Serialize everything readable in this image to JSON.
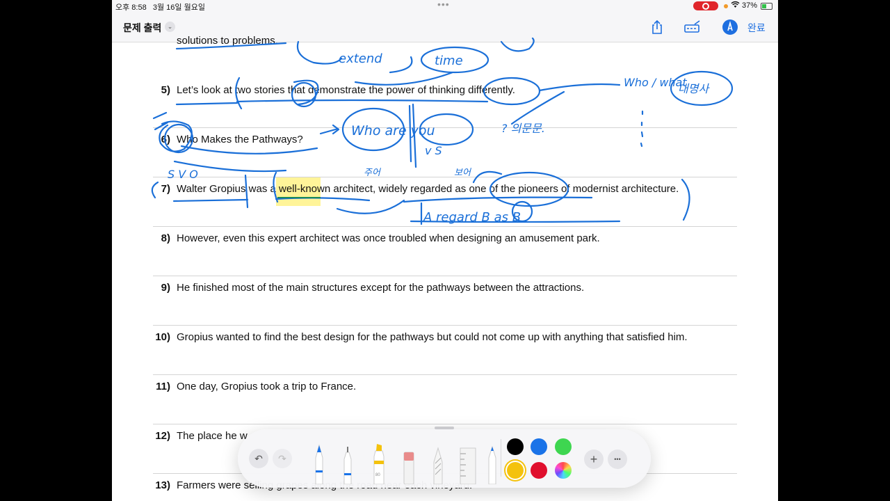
{
  "status": {
    "time": "오후 8:58",
    "date": "3월 16일 월요일",
    "battery": "37%",
    "more_dots": "•••"
  },
  "nav": {
    "title": "문제 출력",
    "chevron": "⌄",
    "done_label": "완료",
    "icons": [
      "share-icon",
      "markup-icon",
      "pen-circle-icon"
    ]
  },
  "worksheet": {
    "top_fragment": "solutions to problems.",
    "rows": [
      {
        "num": "5)",
        "text": "Let’s look at two stories that demonstrate the power of thinking differently."
      },
      {
        "num": "6)",
        "text": "Who Makes the Pathways?"
      },
      {
        "num": "7)",
        "text": "Walter Gropius was a well-known architect, widely regarded as one of the pioneers of modernist architecture."
      },
      {
        "num": "8)",
        "text": "However, even this expert architect was once troubled when designing an amusement park."
      },
      {
        "num": "9)",
        "text": "He finished most of the main structures except for the pathways between the attractions."
      },
      {
        "num": "10)",
        "text": "Gropius wanted to find the best design for the pathways but could not come up with anything that satisfied him."
      },
      {
        "num": "11)",
        "text": "One day, Gropius took a trip to France."
      },
      {
        "num": "12)",
        "text": "The place he w"
      },
      {
        "num": "13)",
        "text": "Farmers were selling grapes along the road near each vineyard."
      }
    ],
    "highlighted_phrase": "well-known"
  },
  "handwriting": {
    "extend": "extend",
    "time": "time",
    "who_what": "Who / what",
    "pronoun_kr": "대명사",
    "who_are_you": "Who are you",
    "question_kr": "? 의문문.",
    "v_s": "v S",
    "s_v_o": "S V O",
    "subject_kr": "주어",
    "complement_kr": "보어",
    "regard_rule": "A regard B as B"
  },
  "toolbar": {
    "undo": "↶",
    "redo": "↷",
    "add": "+",
    "more": "•••",
    "tools": [
      "pen",
      "fineliner",
      "highlighter",
      "eraser",
      "lasso",
      "ruler",
      "pencil"
    ],
    "highlighter_size": "80",
    "colors": [
      "#000000",
      "#1a73e8",
      "#3ed650",
      "#f4c20d",
      "#e0102e"
    ],
    "selected_color": "#f4c20d"
  }
}
